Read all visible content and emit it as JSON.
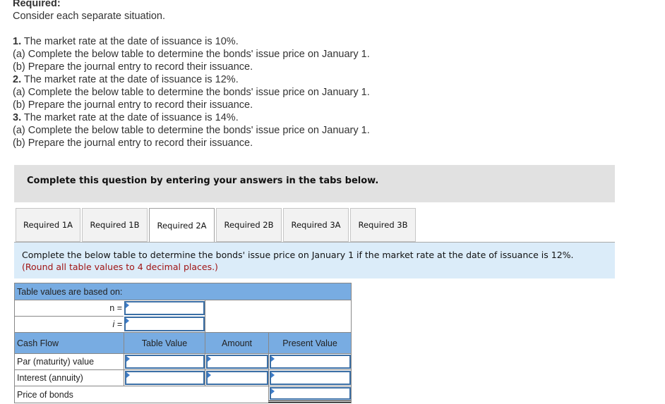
{
  "intro": {
    "heading": "Required:",
    "subheading": "Consider each separate situation.",
    "situations": [
      {
        "number": "1.",
        "text": " The market rate at the date of issuance is 10%.",
        "a": "(a) Complete the below table to determine the bonds' issue price on January 1.",
        "b": "(b) Prepare the journal entry to record their issuance."
      },
      {
        "number": "2.",
        "text": " The market rate at the date of issuance is 12%.",
        "a": "(a) Complete the below table to determine the bonds' issue price on January 1.",
        "b": "(b) Prepare the journal entry to record their issuance."
      },
      {
        "number": "3.",
        "text": " The market rate at the date of issuance is 14%.",
        "a": "(a) Complete the below table to determine the bonds' issue price on January 1.",
        "b": "(b) Prepare the journal entry to record their issuance."
      }
    ]
  },
  "instruction": "Complete this question by entering your answers in the tabs below.",
  "tabs": [
    {
      "label": "Required 1A",
      "active": false
    },
    {
      "label": "Required 1B",
      "active": false
    },
    {
      "label": "Required 2A",
      "active": true
    },
    {
      "label": "Required 2B",
      "active": false
    },
    {
      "label": "Required 3A",
      "active": false
    },
    {
      "label": "Required 3B",
      "active": false
    }
  ],
  "prompt": {
    "text": "Complete the below table to determine the bonds' issue price on January 1 if the market rate at the date of issuance is 12%.",
    "note": "(Round all table values to 4 decimal places.)"
  },
  "table": {
    "based_on_label": "Table values are based on:",
    "n_label": "n =",
    "i_label": "i =",
    "n_value": "",
    "i_value": "",
    "headers": [
      "Cash Flow",
      "Table Value",
      "Amount",
      "Present Value"
    ],
    "rows": [
      {
        "label": "Par (maturity) value",
        "table_value": "",
        "amount": "",
        "present_value": ""
      },
      {
        "label": "Interest (annuity)",
        "table_value": "",
        "amount": "",
        "present_value": ""
      }
    ],
    "total": {
      "label": "Price of bonds",
      "present_value": ""
    }
  }
}
